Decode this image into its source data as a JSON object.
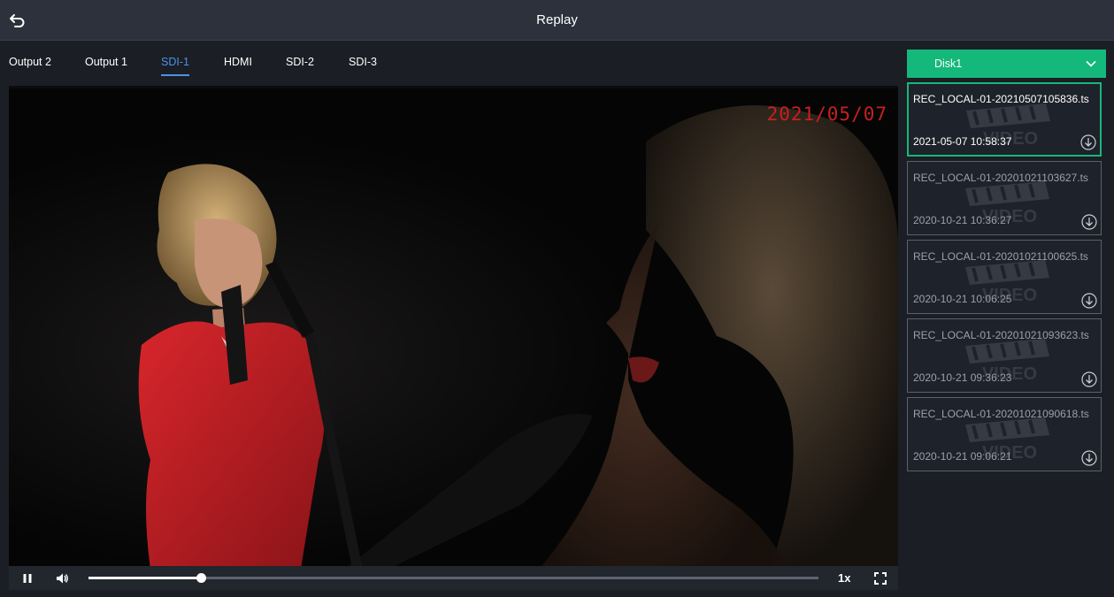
{
  "header": {
    "title": "Replay",
    "back_icon": "back-icon"
  },
  "tabs": [
    {
      "label": "Output 2",
      "active": false
    },
    {
      "label": "Output 1",
      "active": false
    },
    {
      "label": "SDI-1",
      "active": true
    },
    {
      "label": "HDMI",
      "active": false
    },
    {
      "label": "SDI-2",
      "active": false
    },
    {
      "label": "SDI-3",
      "active": false
    }
  ],
  "player": {
    "osd_date": "2021/05/07",
    "playback_state": "playing",
    "progress_fraction": 0.154,
    "speed": "1x",
    "icons": [
      "pause-icon",
      "volume-icon",
      "fullscreen-icon"
    ]
  },
  "disk": {
    "selected": "Disk1"
  },
  "recordings": [
    {
      "name": "REC_LOCAL-01-20210507105836.ts",
      "time": "2021-05-07 10:58:37",
      "selected": true
    },
    {
      "name": "REC_LOCAL-01-20201021103627.ts",
      "time": "2020-10-21 10:36:27",
      "selected": false
    },
    {
      "name": "REC_LOCAL-01-20201021100625.ts",
      "time": "2020-10-21 10:06:25",
      "selected": false
    },
    {
      "name": "REC_LOCAL-01-20201021093623.ts",
      "time": "2020-10-21 09:36:23",
      "selected": false
    },
    {
      "name": "REC_LOCAL-01-20201021090618.ts",
      "time": "2020-10-21 09:06:21",
      "selected": false
    }
  ],
  "colors": {
    "accent_green": "#14b87a",
    "tab_active": "#4b93e6",
    "osd_red": "#c8201e",
    "topbar": "#2c313b",
    "background": "#1b1e25"
  }
}
